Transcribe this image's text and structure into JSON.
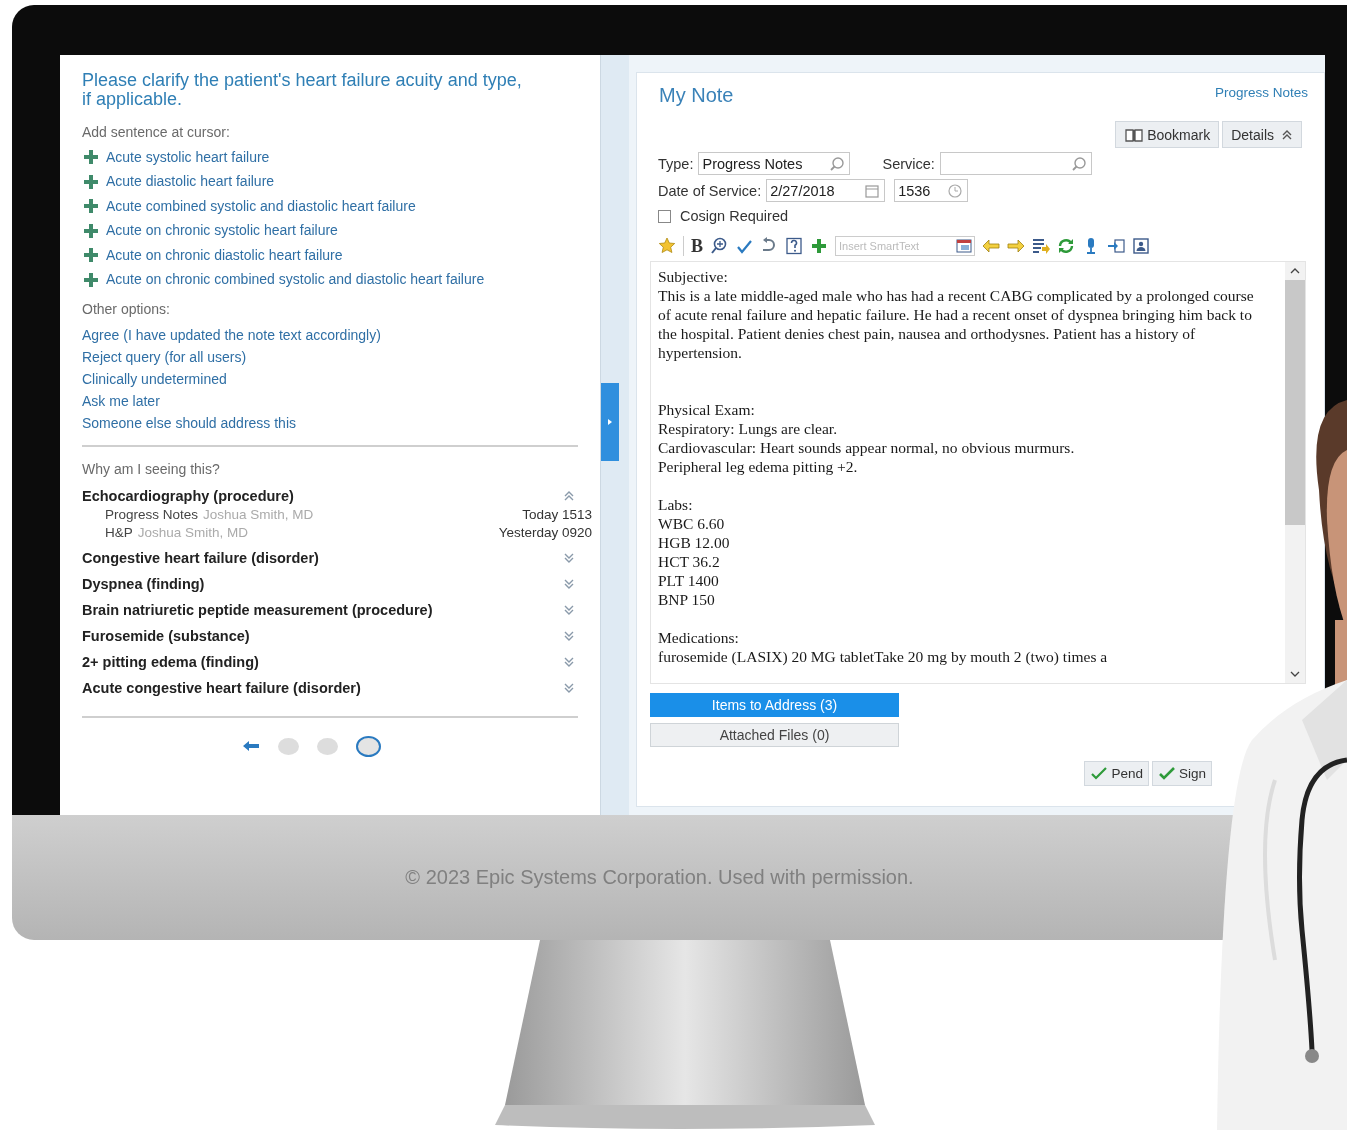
{
  "query_panel": {
    "title": "Please clarify the patient's heart failure acuity and type, if applicable.",
    "add_label": "Add sentence at cursor:",
    "sentences": [
      "Acute systolic heart failure",
      "Acute diastolic heart failure",
      "Acute combined systolic and diastolic heart failure",
      "Acute on chronic systolic heart failure",
      "Acute on chronic diastolic heart failure",
      "Acute on chronic combined systolic and diastolic heart failure"
    ],
    "other_label": "Other options:",
    "options": [
      "Agree (I have updated the note text accordingly)",
      "Reject query (for all users)",
      "Clinically undetermined",
      "Ask me later",
      "Someone else should address this"
    ],
    "why_label": "Why am I seeing this?",
    "reasons": [
      {
        "title": "Echocardiography (procedure)",
        "expanded": true,
        "sources": [
          {
            "note": "Progress Notes",
            "author": "Joshua Smith, MD",
            "time": "Today 1513"
          },
          {
            "note": "H&P",
            "author": "Joshua Smith, MD",
            "time": "Yesterday 0920"
          }
        ]
      },
      {
        "title": "Congestive heart failure (disorder)",
        "expanded": false
      },
      {
        "title": "Dyspnea (finding)",
        "expanded": false
      },
      {
        "title": "Brain natriuretic peptide measurement (procedure)",
        "expanded": false
      },
      {
        "title": "Furosemide (substance)",
        "expanded": false
      },
      {
        "title": "2+ pitting edema (finding)",
        "expanded": false
      },
      {
        "title": "Acute congestive heart failure (disorder)",
        "expanded": false
      }
    ],
    "pager": [
      {
        "selected": false
      },
      {
        "selected": false
      },
      {
        "selected": true
      }
    ]
  },
  "note": {
    "title": "My Note",
    "type_link": "Progress Notes",
    "buttons": [
      "Bookmark",
      "Details"
    ],
    "type_label": "Type:",
    "type_value": "Progress Notes",
    "service_label": "Service:",
    "date_label": "Date of Service:",
    "date_value": "2/27/2018",
    "time_value": "1536",
    "cosign": {
      "label": "Cosign Required",
      "checked": false
    },
    "bold_glyph": "B",
    "smarttext_placeholder": "Insert SmartText",
    "sections": [
      {
        "heading": "Subjective:",
        "lines": [
          "This is a late middle-aged male who has had a recent CABG complicated by a prolonged course of acute renal failure and hepatic failure. He had a recent onset of dyspnea bringing him back to the hospital. Patient denies chest pain, nausea and orthodysnes. Patient has a history of hypertension."
        ]
      },
      {
        "heading": "Physical Exam:",
        "lines": [
          "Respiratory: Lungs are clear.",
          "Cardiovascular: Heart sounds appear normal, no obvious murmurs.",
          "Peripheral leg edema pitting +2."
        ]
      },
      {
        "heading": "Labs:",
        "lines": [
          "WBC 6.60",
          "HGB 12.00",
          "HCT 36.2",
          "PLT 1400",
          "BNP 150"
        ]
      },
      {
        "heading": "Medications:",
        "lines": [
          "furosemide (LASIX) 20 MG tabletTake 20 mg by mouth 2 (two) times a"
        ]
      }
    ],
    "tabs": [
      {
        "label": "Items to Address (3)",
        "selected": true
      },
      {
        "label": "Attached Files (0)",
        "selected": false
      }
    ],
    "actions": [
      "Pend",
      "Sign"
    ]
  },
  "footer": "© 2023 Epic Systems Corporation. Used with permission."
}
